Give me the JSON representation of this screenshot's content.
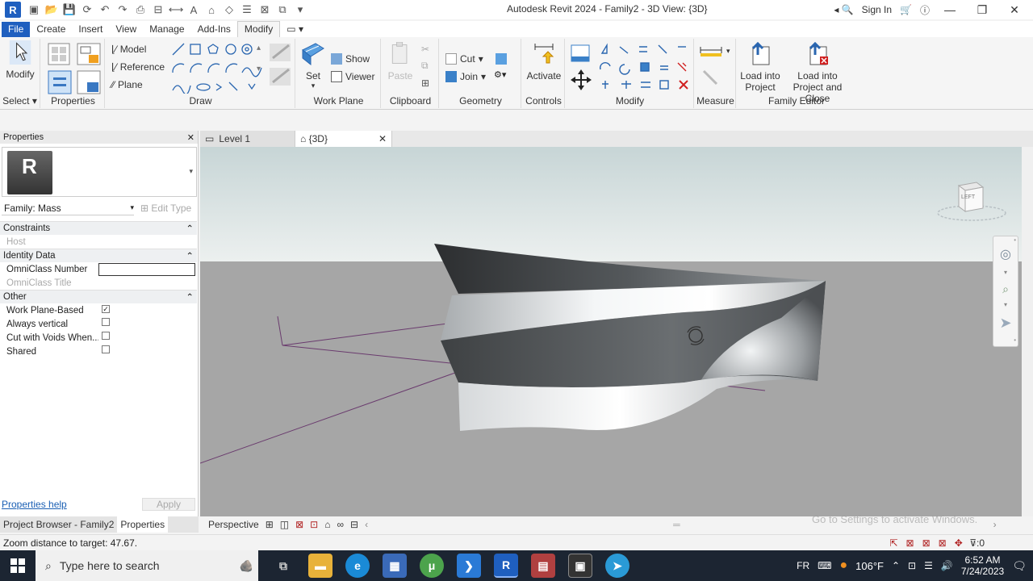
{
  "app": {
    "title": "Autodesk Revit 2024 - Family2 - 3D View: {3D}",
    "sign_in": "Sign In",
    "logo_letter": "R"
  },
  "ribbon_tabs": [
    "File",
    "Create",
    "Insert",
    "View",
    "Manage",
    "Add-Ins",
    "Modify"
  ],
  "ribbon": {
    "select": {
      "modify_label": "Modify",
      "select_label": "Select"
    },
    "properties_label": "Properties",
    "draw": {
      "model": "Model",
      "reference": "Reference",
      "plane": "Plane",
      "label": "Draw"
    },
    "work_plane": {
      "set": "Set",
      "show": "Show",
      "viewer": "Viewer",
      "label": "Work Plane"
    },
    "clipboard": {
      "paste": "Paste",
      "label": "Clipboard"
    },
    "geometry": {
      "cut": "Cut",
      "join": "Join",
      "label": "Geometry"
    },
    "controls": {
      "activate": "Activate",
      "label": "Controls"
    },
    "modify_label": "Modify",
    "measure_label": "Measure",
    "family_editor": {
      "load_into_project": "Load into Project",
      "load_and_close": "Load into Project and Close",
      "label": "Family Editor"
    }
  },
  "properties": {
    "header": "Properties",
    "family_label": "Family: Mass",
    "edit_type": "Edit Type",
    "groups": [
      {
        "name": "Constraints",
        "rows": [
          {
            "key": "Host",
            "type": "dim"
          }
        ]
      },
      {
        "name": "Identity Data",
        "rows": [
          {
            "key": "OmniClass Number",
            "type": "box"
          },
          {
            "key": "OmniClass Title",
            "type": "dim"
          }
        ]
      },
      {
        "name": "Other",
        "rows": [
          {
            "key": "Work Plane-Based",
            "type": "check",
            "checked": true
          },
          {
            "key": "Always vertical",
            "type": "check",
            "checked": false
          },
          {
            "key": "Cut with Voids When...",
            "type": "check",
            "checked": false
          },
          {
            "key": "Shared",
            "type": "check",
            "checked": false
          }
        ]
      }
    ],
    "help_link": "Properties help",
    "apply": "Apply",
    "bottom_tabs": [
      "Project Browser - Family2",
      "Properties"
    ]
  },
  "view_tabs": [
    {
      "label": "Level 1",
      "active": false
    },
    {
      "label": "{3D}",
      "active": true
    }
  ],
  "viewcube_label": "LEFT",
  "view_bar": {
    "mode": "Perspective"
  },
  "watermark": "Go to Settings to activate Windows.",
  "status": {
    "text": "Zoom distance to target: 47.67.",
    "filter_count": ":0"
  },
  "taskbar": {
    "search_placeholder": "Type here to search",
    "language": "FR",
    "temperature": "106°F",
    "time": "6:52 AM",
    "date": "7/24/2023"
  }
}
